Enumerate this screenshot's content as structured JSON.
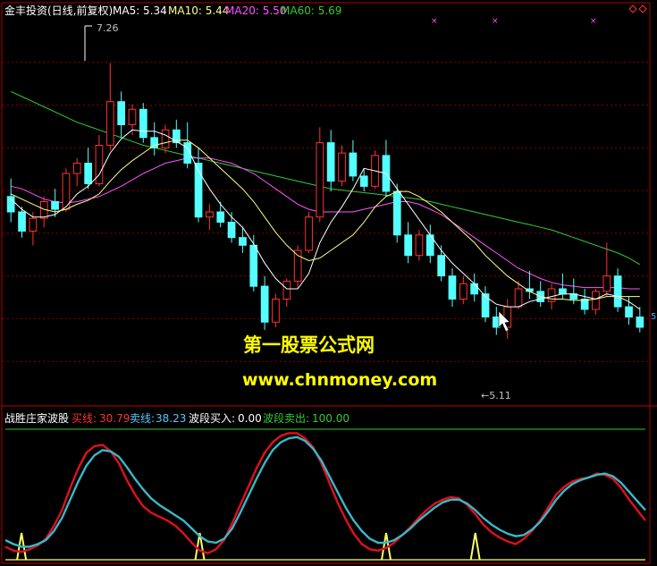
{
  "header": {
    "title": "金丰投资(日线,前复权)",
    "ma5_label": "MA5: 5.34",
    "ma10_label": "MA10: 5.44",
    "ma20_label": "MA20: 5.50",
    "ma60_label": "MA60: 5.69"
  },
  "price_panel": {
    "high_label": "7.26",
    "low_label": "←5.11",
    "right_edge_value": "5"
  },
  "watermark": {
    "line1": "第一股票公式网",
    "line2": "www.chnmoney.com"
  },
  "indicator": {
    "name": "战胜庄家波股",
    "buy_label": "买线:",
    "buy_value": "30.79",
    "sell_label": "卖线:",
    "sell_value": "38.23",
    "wave_buy_label": "波段买入:",
    "wave_buy_value": "0.00",
    "wave_sell_label": "波段卖出:",
    "wave_sell_value": "100.00"
  },
  "colors": {
    "background": "#000000",
    "up": "#ff3232",
    "down": "#54ffff",
    "ma5": "#ffffff",
    "ma10": "#ffff8c",
    "ma20": "#ff55ff",
    "ma60": "#33cc33",
    "grid": "#8b0000",
    "buy_line": "#e01020",
    "sell_line": "#3ab8c8",
    "spike": "#ffff66",
    "watermark": "#ffff00"
  },
  "chart_data": [
    {
      "type": "candlestick",
      "title": "金丰投资(日线,前复权)",
      "ylim": [
        4.6,
        7.6
      ],
      "price_high": 7.26,
      "price_low": 5.11,
      "candles": [
        {
          "o": 6.22,
          "h": 6.36,
          "l": 6.02,
          "c": 6.1
        },
        {
          "o": 6.1,
          "h": 6.14,
          "l": 5.9,
          "c": 5.95
        },
        {
          "o": 5.95,
          "h": 6.1,
          "l": 5.84,
          "c": 6.05
        },
        {
          "o": 6.05,
          "h": 6.22,
          "l": 5.98,
          "c": 6.18
        },
        {
          "o": 6.18,
          "h": 6.28,
          "l": 6.06,
          "c": 6.12
        },
        {
          "o": 6.12,
          "h": 6.44,
          "l": 6.1,
          "c": 6.4
        },
        {
          "o": 6.4,
          "h": 6.52,
          "l": 6.3,
          "c": 6.48
        },
        {
          "o": 6.48,
          "h": 6.6,
          "l": 6.28,
          "c": 6.32
        },
        {
          "o": 6.32,
          "h": 6.7,
          "l": 6.3,
          "c": 6.62
        },
        {
          "o": 6.62,
          "h": 7.26,
          "l": 6.58,
          "c": 6.96
        },
        {
          "o": 6.96,
          "h": 7.04,
          "l": 6.68,
          "c": 6.78
        },
        {
          "o": 6.78,
          "h": 6.94,
          "l": 6.7,
          "c": 6.9
        },
        {
          "o": 6.9,
          "h": 6.95,
          "l": 6.64,
          "c": 6.68
        },
        {
          "o": 6.68,
          "h": 6.8,
          "l": 6.54,
          "c": 6.6
        },
        {
          "o": 6.6,
          "h": 6.78,
          "l": 6.56,
          "c": 6.74
        },
        {
          "o": 6.74,
          "h": 6.82,
          "l": 6.6,
          "c": 6.64
        },
        {
          "o": 6.64,
          "h": 6.8,
          "l": 6.44,
          "c": 6.48
        },
        {
          "o": 6.48,
          "h": 6.6,
          "l": 6.02,
          "c": 6.06
        },
        {
          "o": 6.06,
          "h": 6.16,
          "l": 5.96,
          "c": 6.1
        },
        {
          "o": 6.1,
          "h": 6.18,
          "l": 5.98,
          "c": 6.02
        },
        {
          "o": 6.02,
          "h": 6.1,
          "l": 5.86,
          "c": 5.9
        },
        {
          "o": 5.9,
          "h": 5.98,
          "l": 5.78,
          "c": 5.84
        },
        {
          "o": 5.84,
          "h": 5.92,
          "l": 5.48,
          "c": 5.52
        },
        {
          "o": 5.52,
          "h": 5.6,
          "l": 5.18,
          "c": 5.24
        },
        {
          "o": 5.24,
          "h": 5.46,
          "l": 5.2,
          "c": 5.42
        },
        {
          "o": 5.42,
          "h": 5.58,
          "l": 5.36,
          "c": 5.56
        },
        {
          "o": 5.56,
          "h": 5.84,
          "l": 5.5,
          "c": 5.8
        },
        {
          "o": 5.8,
          "h": 6.1,
          "l": 5.78,
          "c": 6.06
        },
        {
          "o": 6.06,
          "h": 6.76,
          "l": 6.02,
          "c": 6.64
        },
        {
          "o": 6.64,
          "h": 6.74,
          "l": 6.26,
          "c": 6.34
        },
        {
          "o": 6.34,
          "h": 6.62,
          "l": 6.3,
          "c": 6.56
        },
        {
          "o": 6.56,
          "h": 6.66,
          "l": 6.34,
          "c": 6.38
        },
        {
          "o": 6.38,
          "h": 6.44,
          "l": 6.26,
          "c": 6.3
        },
        {
          "o": 6.3,
          "h": 6.58,
          "l": 6.28,
          "c": 6.54
        },
        {
          "o": 6.54,
          "h": 6.66,
          "l": 6.22,
          "c": 6.26
        },
        {
          "o": 6.26,
          "h": 6.32,
          "l": 5.86,
          "c": 5.92
        },
        {
          "o": 5.92,
          "h": 6.02,
          "l": 5.7,
          "c": 5.76
        },
        {
          "o": 5.76,
          "h": 5.96,
          "l": 5.72,
          "c": 5.92
        },
        {
          "o": 5.92,
          "h": 6.0,
          "l": 5.7,
          "c": 5.76
        },
        {
          "o": 5.76,
          "h": 5.84,
          "l": 5.56,
          "c": 5.6
        },
        {
          "o": 5.6,
          "h": 5.66,
          "l": 5.36,
          "c": 5.42
        },
        {
          "o": 5.42,
          "h": 5.6,
          "l": 5.38,
          "c": 5.54
        },
        {
          "o": 5.54,
          "h": 5.62,
          "l": 5.4,
          "c": 5.46
        },
        {
          "o": 5.46,
          "h": 5.52,
          "l": 5.24,
          "c": 5.28
        },
        {
          "o": 5.28,
          "h": 5.36,
          "l": 5.14,
          "c": 5.2
        },
        {
          "o": 5.2,
          "h": 5.42,
          "l": 5.11,
          "c": 5.36
        },
        {
          "o": 5.36,
          "h": 5.56,
          "l": 5.34,
          "c": 5.5
        },
        {
          "o": 5.5,
          "h": 5.64,
          "l": 5.42,
          "c": 5.48
        },
        {
          "o": 5.48,
          "h": 5.56,
          "l": 5.36,
          "c": 5.4
        },
        {
          "o": 5.4,
          "h": 5.54,
          "l": 5.34,
          "c": 5.5
        },
        {
          "o": 5.5,
          "h": 5.62,
          "l": 5.42,
          "c": 5.46
        },
        {
          "o": 5.46,
          "h": 5.58,
          "l": 5.38,
          "c": 5.42
        },
        {
          "o": 5.42,
          "h": 5.5,
          "l": 5.3,
          "c": 5.34
        },
        {
          "o": 5.34,
          "h": 5.5,
          "l": 5.3,
          "c": 5.48
        },
        {
          "o": 5.48,
          "h": 5.86,
          "l": 5.44,
          "c": 5.6
        },
        {
          "o": 5.6,
          "h": 5.66,
          "l": 5.32,
          "c": 5.36
        },
        {
          "o": 5.36,
          "h": 5.44,
          "l": 5.22,
          "c": 5.28
        },
        {
          "o": 5.28,
          "h": 5.36,
          "l": 5.16,
          "c": 5.2
        }
      ],
      "ma5": [
        6.2,
        6.12,
        6.06,
        6.06,
        6.08,
        6.14,
        6.24,
        6.3,
        6.39,
        6.56,
        6.67,
        6.74,
        6.73,
        6.73,
        6.7,
        6.65,
        6.6,
        6.42,
        6.28,
        6.16,
        6.06,
        5.98,
        5.85,
        5.7,
        5.58,
        5.5,
        5.5,
        5.62,
        5.86,
        6.02,
        6.14,
        6.28,
        6.44,
        6.42,
        6.4,
        6.28,
        6.16,
        6.04,
        5.92,
        5.8,
        5.7,
        5.62,
        5.54,
        5.44,
        5.38,
        5.36,
        5.36,
        5.4,
        5.42,
        5.44,
        5.46,
        5.46,
        5.44,
        5.42,
        5.46,
        5.44,
        5.4,
        5.34
      ],
      "ma10": [
        6.24,
        6.2,
        6.16,
        6.12,
        6.1,
        6.12,
        6.16,
        6.19,
        6.24,
        6.34,
        6.43,
        6.5,
        6.56,
        6.62,
        6.64,
        6.66,
        6.66,
        6.6,
        6.52,
        6.44,
        6.36,
        6.28,
        6.18,
        6.06,
        5.94,
        5.84,
        5.76,
        5.72,
        5.74,
        5.8,
        5.86,
        5.92,
        6.02,
        6.14,
        6.22,
        6.26,
        6.26,
        6.22,
        6.16,
        6.1,
        6.02,
        5.94,
        5.86,
        5.76,
        5.68,
        5.6,
        5.54,
        5.48,
        5.44,
        5.42,
        5.42,
        5.41,
        5.41,
        5.42,
        5.44,
        5.44,
        5.44,
        5.44
      ],
      "ma20": [
        6.3,
        6.28,
        6.24,
        6.2,
        6.18,
        6.17,
        6.18,
        6.2,
        6.22,
        6.26,
        6.3,
        6.35,
        6.4,
        6.44,
        6.48,
        6.5,
        6.52,
        6.52,
        6.52,
        6.5,
        6.48,
        6.44,
        6.4,
        6.34,
        6.28,
        6.22,
        6.16,
        6.12,
        6.1,
        6.1,
        6.1,
        6.1,
        6.12,
        6.14,
        6.16,
        6.18,
        6.18,
        6.16,
        6.12,
        6.08,
        6.02,
        5.96,
        5.9,
        5.84,
        5.78,
        5.72,
        5.66,
        5.62,
        5.58,
        5.55,
        5.53,
        5.52,
        5.51,
        5.51,
        5.51,
        5.51,
        5.5,
        5.5
      ],
      "ma60": [
        7.04,
        7.0,
        6.96,
        6.92,
        6.88,
        6.84,
        6.8,
        6.77,
        6.74,
        6.71,
        6.68,
        6.65,
        6.62,
        6.6,
        6.58,
        6.56,
        6.54,
        6.52,
        6.5,
        6.48,
        6.46,
        6.44,
        6.42,
        6.4,
        6.38,
        6.36,
        6.34,
        6.32,
        6.3,
        6.28,
        6.27,
        6.26,
        6.25,
        6.24,
        6.23,
        6.22,
        6.21,
        6.2,
        6.18,
        6.16,
        6.14,
        6.12,
        6.1,
        6.08,
        6.06,
        6.04,
        6.02,
        6.0,
        5.98,
        5.96,
        5.93,
        5.9,
        5.87,
        5.84,
        5.81,
        5.78,
        5.74,
        5.69
      ]
    },
    {
      "type": "line",
      "title": "战胜庄家波股",
      "ylim": [
        0,
        100
      ],
      "series": [
        {
          "name": "买线",
          "values": [
            10,
            7,
            6,
            8,
            11,
            16,
            26,
            38,
            55,
            70,
            82,
            87,
            88,
            83,
            74,
            61,
            50,
            41,
            36,
            33,
            30,
            26,
            20,
            13,
            7,
            5,
            8,
            15,
            28,
            42,
            56,
            70,
            82,
            90,
            95,
            97,
            97,
            93,
            86,
            74,
            59,
            44,
            31,
            20,
            12,
            8,
            7,
            9,
            13,
            19,
            25,
            32,
            38,
            43,
            46,
            48,
            47,
            42,
            35,
            27,
            21,
            17,
            14,
            12,
            16,
            22,
            30,
            40,
            50,
            56,
            60,
            62,
            63,
            66,
            65,
            62,
            55,
            46,
            38,
            30
          ]
        },
        {
          "name": "卖线",
          "values": [
            15,
            12,
            10,
            10,
            12,
            15,
            22,
            32,
            46,
            60,
            72,
            80,
            84,
            83,
            79,
            71,
            62,
            54,
            47,
            42,
            38,
            34,
            30,
            24,
            18,
            14,
            13,
            16,
            24,
            36,
            49,
            62,
            74,
            84,
            90,
            93,
            94,
            91,
            85,
            76,
            64,
            52,
            40,
            30,
            22,
            16,
            13,
            13,
            15,
            19,
            24,
            30,
            35,
            40,
            44,
            46,
            46,
            43,
            38,
            32,
            27,
            23,
            20,
            18,
            19,
            23,
            29,
            37,
            46,
            53,
            58,
            61,
            63,
            65,
            66,
            64,
            59,
            52,
            45,
            38
          ]
        },
        {
          "name": "波段买入",
          "values": [
            0,
            0,
            0,
            0,
            0,
            0,
            0,
            0,
            0,
            0,
            0,
            0,
            0,
            0,
            0,
            0,
            0,
            0,
            0,
            0,
            0,
            0,
            0,
            0,
            0,
            0,
            0,
            0,
            0,
            0,
            0,
            0,
            0,
            0,
            0,
            0,
            0,
            0,
            0,
            0,
            0,
            0,
            0,
            0,
            0,
            0,
            0,
            0,
            0,
            0,
            0,
            0,
            0,
            0,
            0,
            0,
            0,
            0,
            0,
            0,
            0,
            0,
            0,
            0,
            0,
            0,
            0,
            0,
            0,
            0,
            0,
            0,
            0,
            0,
            0,
            0,
            0,
            0,
            0,
            0
          ]
        },
        {
          "name": "波段卖出",
          "values": [
            100,
            100,
            100,
            100,
            100,
            100,
            100,
            100,
            100,
            100,
            100,
            100,
            100,
            100,
            100,
            100,
            100,
            100,
            100,
            100,
            100,
            100,
            100,
            100,
            100,
            100,
            100,
            100,
            100,
            100,
            100,
            100,
            100,
            100,
            100,
            100,
            100,
            100,
            100,
            100,
            100,
            100,
            100,
            100,
            100,
            100,
            100,
            100,
            100,
            100,
            100,
            100,
            100,
            100,
            100,
            100,
            100,
            100,
            100,
            100,
            100,
            100,
            100,
            100,
            100,
            100,
            100,
            100,
            100,
            100,
            100,
            100,
            100,
            100,
            100,
            100,
            100,
            100,
            100,
            100
          ]
        }
      ],
      "buy_signal_indices": [
        2,
        24,
        47,
        58
      ]
    }
  ]
}
